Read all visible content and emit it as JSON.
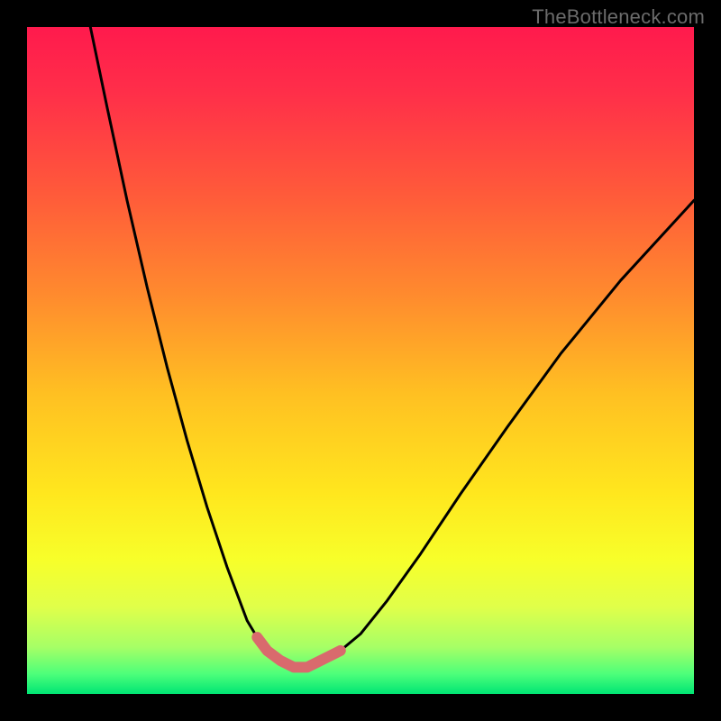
{
  "watermark": "TheBottleneck.com",
  "colors": {
    "frame": "#000000",
    "curve": "#000000",
    "highlight": "#d96a6d",
    "gradient_stops": [
      {
        "offset": 0.0,
        "color": "#ff1a4d"
      },
      {
        "offset": 0.1,
        "color": "#ff2f49"
      },
      {
        "offset": 0.25,
        "color": "#ff5a3a"
      },
      {
        "offset": 0.4,
        "color": "#ff8a2e"
      },
      {
        "offset": 0.55,
        "color": "#ffc022"
      },
      {
        "offset": 0.7,
        "color": "#ffe71e"
      },
      {
        "offset": 0.8,
        "color": "#f7ff2a"
      },
      {
        "offset": 0.87,
        "color": "#e0ff4a"
      },
      {
        "offset": 0.93,
        "color": "#a6ff66"
      },
      {
        "offset": 0.97,
        "color": "#4dff7a"
      },
      {
        "offset": 1.0,
        "color": "#00e574"
      }
    ]
  },
  "chart_data": {
    "type": "line",
    "title": "",
    "xlabel": "",
    "ylabel": "",
    "xlim": [
      0,
      100
    ],
    "ylim": [
      0,
      100
    ],
    "grid": false,
    "series": [
      {
        "name": "left-branch",
        "x": [
          9.5,
          12,
          15,
          18,
          21,
          24,
          27,
          30,
          33,
          34.5,
          36
        ],
        "y": [
          100,
          88,
          74,
          61,
          49,
          38,
          28,
          19,
          11,
          8.5,
          6.5
        ]
      },
      {
        "name": "right-branch",
        "x": [
          47,
          50,
          54,
          59,
          65,
          72,
          80,
          89,
          100
        ],
        "y": [
          6.5,
          9,
          14,
          21,
          30,
          40,
          51,
          62,
          74
        ]
      },
      {
        "name": "valley-highlight",
        "x": [
          34.5,
          36,
          38,
          40,
          42,
          44,
          46,
          47
        ],
        "y": [
          8.5,
          6.5,
          5,
          4,
          4,
          5,
          6,
          6.5
        ]
      }
    ]
  }
}
